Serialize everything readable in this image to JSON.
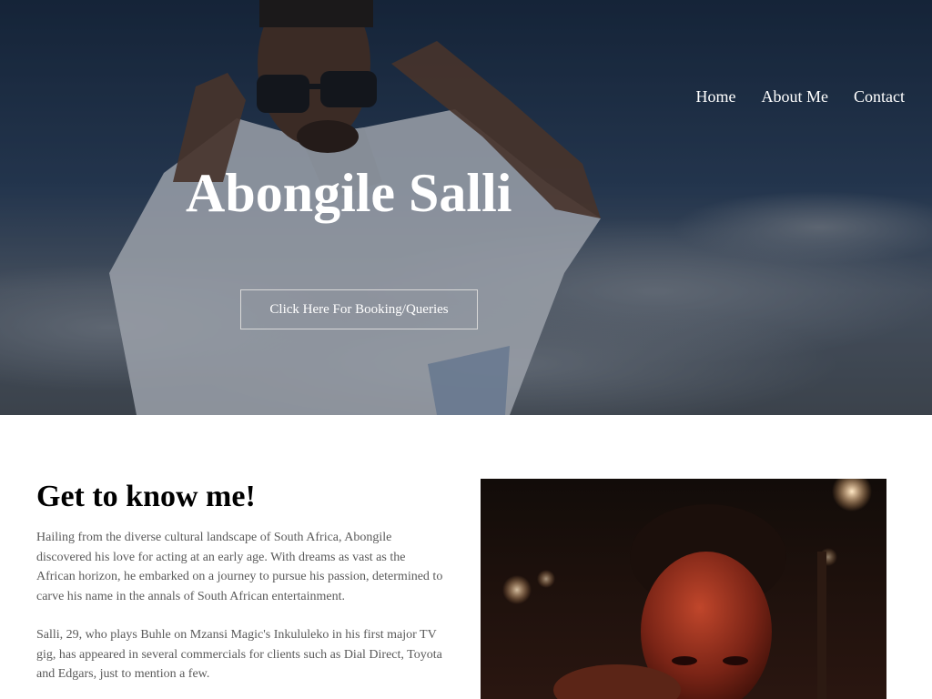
{
  "site": {
    "colors": {
      "hero_overlay": "#1c2f4a",
      "text_muted": "#5a5a5a",
      "heading": "#000000",
      "button_border": "#d8d8d8"
    }
  },
  "nav": {
    "items": [
      {
        "label": "Home"
      },
      {
        "label": "About Me"
      },
      {
        "label": "Contact"
      }
    ]
  },
  "hero": {
    "title": "Abongile Salli",
    "cta_label": "Click Here For Booking/Queries"
  },
  "about": {
    "heading": "Get to know me!",
    "paragraphs": [
      "Hailing from the diverse cultural landscape of South Africa, Abongile discovered his love for acting at an early age. With dreams as vast as the African horizon, he embarked on a journey to pursue his passion, determined to carve his name in the annals of South African entertainment.",
      "Salli, 29, who plays Buhle on Mzansi Magic's Inkululeko in his first major TV gig, has appeared in several commercials for clients such as Dial Direct, Toyota and Edgars, just to mention a few."
    ]
  }
}
